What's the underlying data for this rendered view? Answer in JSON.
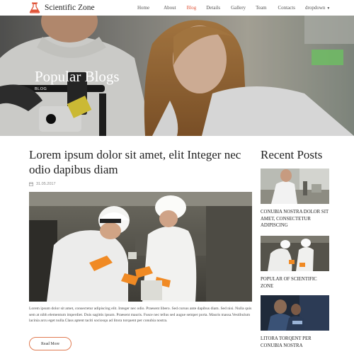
{
  "brand": {
    "name": "Scientific Zone",
    "accent": "#e0553a"
  },
  "nav": {
    "items": [
      {
        "label": "Home",
        "active": false
      },
      {
        "label": "About",
        "active": false
      },
      {
        "label": "Blog",
        "active": true
      },
      {
        "label": "Details",
        "active": false
      },
      {
        "label": "Gallery",
        "active": false
      },
      {
        "label": "Team",
        "active": false
      },
      {
        "label": "Contacts",
        "active": false
      },
      {
        "label": "dropdown",
        "active": false,
        "icon": "caret-down-icon"
      }
    ]
  },
  "hero": {
    "title": "Popular Blogs",
    "breadcrumb": "BLOG"
  },
  "post": {
    "title": "Lorem ipsum dolor sit amet, elit Integer nec odio dapibus diam",
    "date": "31.05.2017",
    "date_icon": "calendar-icon",
    "excerpt": "Lorem ipsum dolor sit amet, consectetur adipiscing elit. Integer nec odio. Praesent libero. Sed cursus ante dapibus diam. Sed nisi. Nulla quis sem at nibh elementum imperdiet. Duis sagittis ipsum. Praesent mauris. Fusce nec tellus sed augue semper porta. Mauris massa.Vestibulum lacinia arcu eget nulla.Class aptent taciti sociosqu ad litora torquent per conubia nostra.",
    "read_more": "Read More"
  },
  "sidebar": {
    "title": "Recent Posts",
    "posts": [
      {
        "title": "CONUBIA NOSTRA DOLOR SIT AMET, CONSECTETUR ADIPISCING"
      },
      {
        "title": "POPULAR OF SCIENTIFIC ZONE"
      },
      {
        "title": "LITORA TORQENT PER CONUBIA NOSTRA"
      }
    ]
  }
}
